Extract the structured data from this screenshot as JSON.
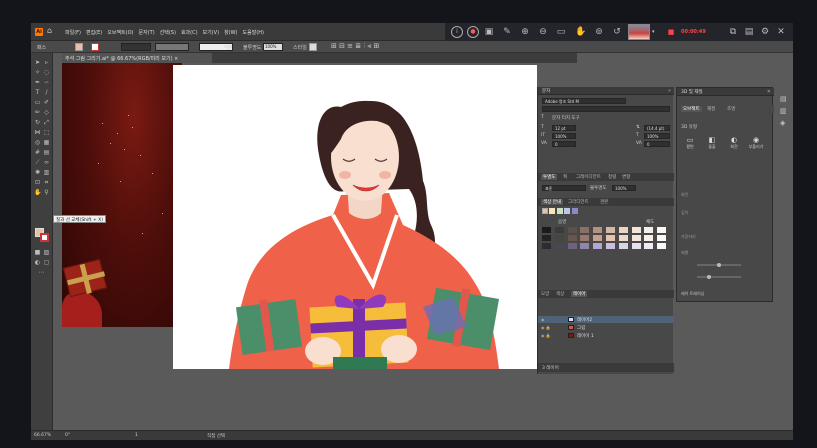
{
  "menubar": {
    "logo_text": "Ai",
    "items": [
      "파일(F)",
      "편집(E)",
      "오브젝트(O)",
      "문자(T)",
      "선택(S)",
      "효과(C)",
      "보기(V)",
      "창(W)",
      "도움말(H)"
    ]
  },
  "recorder": {
    "timer": "00:00:49"
  },
  "options_bar": {
    "label": "패스",
    "stroke_style": "기본",
    "opacity_label": "불투명도",
    "opacity_value": "100%",
    "style_label": "스타일"
  },
  "document_tab": "추석 그림 그리기.ai* @ 66.67%(RGB/미리 보기)",
  "tooltip": "칠과 선 교체(Shift + X)",
  "char_panel": {
    "title": "문자",
    "font": "Adobe 명조 Std M",
    "touch_label": "문자 터치 도구",
    "size": "12 pt",
    "leading": "(14.4 pt)",
    "hscale": "100%",
    "vscale": "100%",
    "tracking": "0",
    "kerning": "0"
  },
  "transparency_panel": {
    "tabs": [
      "투명도",
      "획",
      "그레이디언트",
      "정렬",
      "변형"
    ],
    "mode": "표준",
    "opacity_label": "불투명도",
    "opacity_value": "100%"
  },
  "color_panel": {
    "tabs": [
      "색상 안내",
      "그라디언트",
      "견본"
    ],
    "left_label": "음영",
    "right_label": "채도",
    "colors": [
      "#1a1a1a",
      "#3b3b3b",
      "#5b524c",
      "#8a7065",
      "#b5927f",
      "#d8b6a2",
      "#ecd3c4",
      "#f3e5dc",
      "#f7efe9",
      "#fbf6f3",
      "#222222",
      "#454545",
      "#6a5550",
      "#98786c",
      "#c79f8c",
      "#e6c3ae",
      "#f0d8c9",
      "#f5e6dd",
      "#f8f0ea",
      "#fcf8f5",
      "#2d2a33",
      "#4a4655",
      "#6b6480",
      "#8f86ab",
      "#b1a8d2",
      "#c8c0e2",
      "#d8d2ea",
      "#e6e2f1",
      "#efecf6",
      "#f8f7fb"
    ]
  },
  "layers_panel": {
    "tabs": [
      "모양",
      "색상",
      "레이어"
    ],
    "layers": [
      {
        "name": "레이어2",
        "selected": true
      },
      {
        "name": "그림",
        "selected": false
      },
      {
        "name": "레이어 1",
        "selected": false
      }
    ],
    "footer": "3 레이어"
  },
  "properties_panel": {
    "title": "3D 및 재질",
    "tabs": [
      "오브젝트",
      "재질",
      "조명"
    ],
    "section": "3D 유형",
    "buttons": [
      "평면",
      "돌출",
      "회전",
      "부풀리기"
    ],
    "labels": [
      "회전",
      "깊이",
      "가장자리",
      "베벨",
      "광선 추적"
    ],
    "footer": "레이 트레이싱"
  },
  "status": {
    "zoom": "66.67%",
    "rotation": "0°",
    "artboard": "1",
    "tool": "직접 선택"
  }
}
